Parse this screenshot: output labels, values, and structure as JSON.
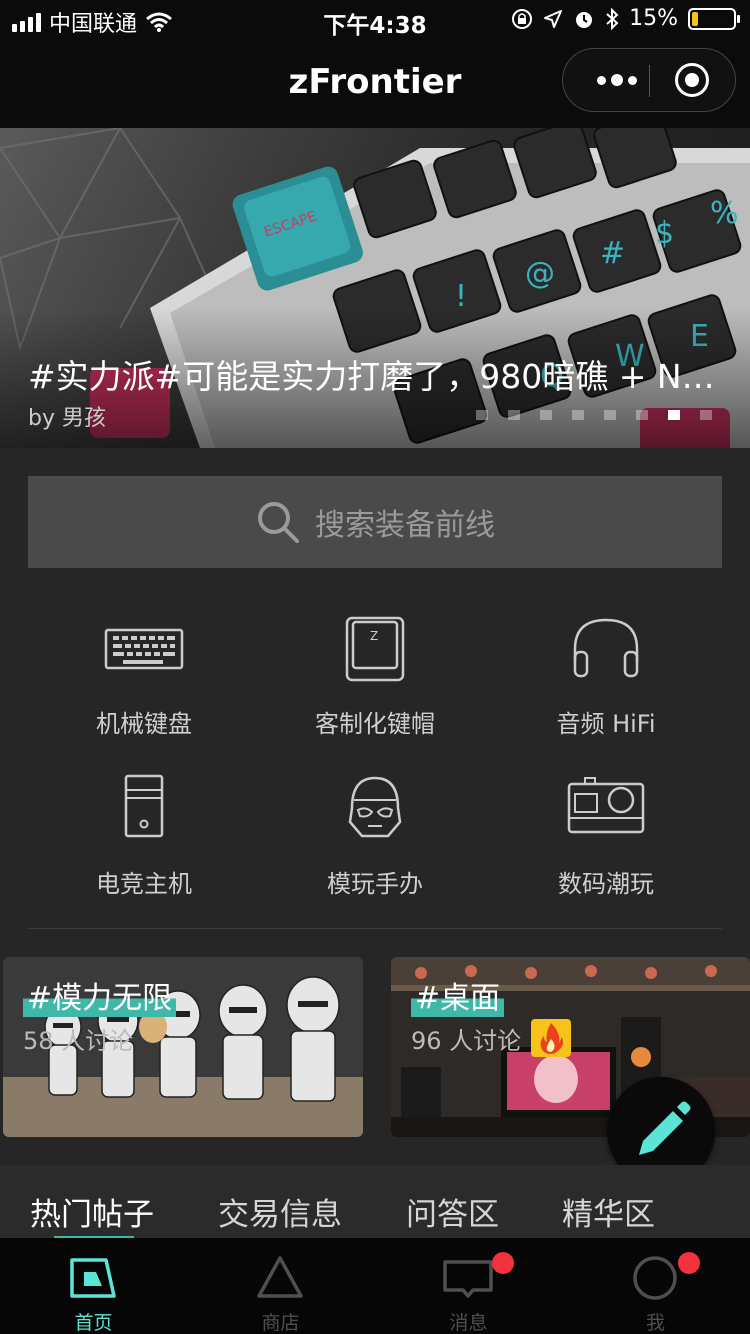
{
  "status_bar": {
    "carrier": "中国联通",
    "time": "下午4:38",
    "battery_percent": "15%",
    "battery_level": 0.15
  },
  "nav": {
    "title": "zFrontier"
  },
  "banner": {
    "title": "#实力派#可能是实力打磨了，980暗礁 + Ni...",
    "author": "by 男孩",
    "page_count": 8,
    "active_page": 6
  },
  "search": {
    "placeholder": "搜索装备前线"
  },
  "categories": [
    {
      "label": "机械键盘",
      "icon": "keyboard-icon"
    },
    {
      "label": "客制化键帽",
      "icon": "keycap-icon"
    },
    {
      "label": "音频 HiFi",
      "icon": "headphones-icon"
    },
    {
      "label": "电竞主机",
      "icon": "pc-tower-icon"
    },
    {
      "label": "模玩手办",
      "icon": "stormtrooper-icon"
    },
    {
      "label": "数码潮玩",
      "icon": "camera-icon"
    }
  ],
  "topics": [
    {
      "title": "#模力无限",
      "discussion": "58 人讨论",
      "hot": false
    },
    {
      "title": "#桌面",
      "discussion": "96 人讨论",
      "hot": true
    }
  ],
  "tabs": [
    "热门帖子",
    "交易信息",
    "问答区",
    "精华区"
  ],
  "tab_active": 0,
  "tabbar": [
    {
      "label": "首页",
      "icon": "home-icon",
      "active": true,
      "badge": false
    },
    {
      "label": "商店",
      "icon": "store-triangle-icon",
      "active": false,
      "badge": false
    },
    {
      "label": "消息",
      "icon": "message-icon",
      "active": false,
      "badge": true
    },
    {
      "label": "我",
      "icon": "profile-icon",
      "active": false,
      "badge": true
    }
  ],
  "colors": {
    "accent": "#5be4d6",
    "badge": "#f2323c",
    "background": "#262626"
  }
}
